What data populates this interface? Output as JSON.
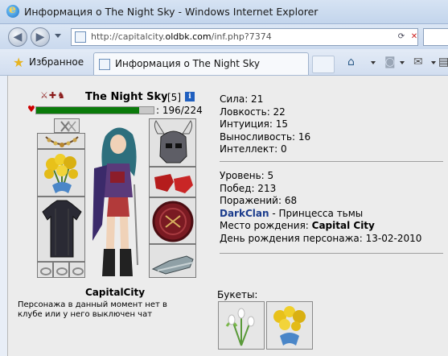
{
  "window": {
    "title": "Информация о The Night Sky - Windows Internet Explorer"
  },
  "nav": {
    "url_prefix": "http://capitalcity.",
    "url_domain": "oldbk.com",
    "url_suffix": "/inf.php?7374"
  },
  "favbar": {
    "favorites_label": "Избранное",
    "tab_label": "Информация о The Night Sky"
  },
  "character": {
    "name": "The Night Sky",
    "level": "[5]",
    "hp_current": 196,
    "hp_max": 224,
    "hp_text": ": 196/224",
    "location": "CapitalCity",
    "club_status": "Персонажа в данный момент нет в клубе или у него выключен чат"
  },
  "stats": {
    "strength": "Сила: 21",
    "agility": "Ловкость: 22",
    "intuition": "Интуиция: 15",
    "endurance": "Выносливость: 16",
    "intellect": "Интеллект: 0"
  },
  "info": {
    "level": "Уровень: 5",
    "wins": "Побед: 213",
    "losses": "Поражений: 68",
    "clan": "DarkClan",
    "clan_title": " - Принцесса тьмы",
    "birthplace_label": "Место рождения: ",
    "birthplace": "Capital City",
    "birthday": "День рождения персонажа: 13-02-2010"
  },
  "bouquets": {
    "label": "Букеты:"
  },
  "colors": {
    "hp_bar": "#0a7a0a",
    "clan_link": "#1a3b8c"
  }
}
